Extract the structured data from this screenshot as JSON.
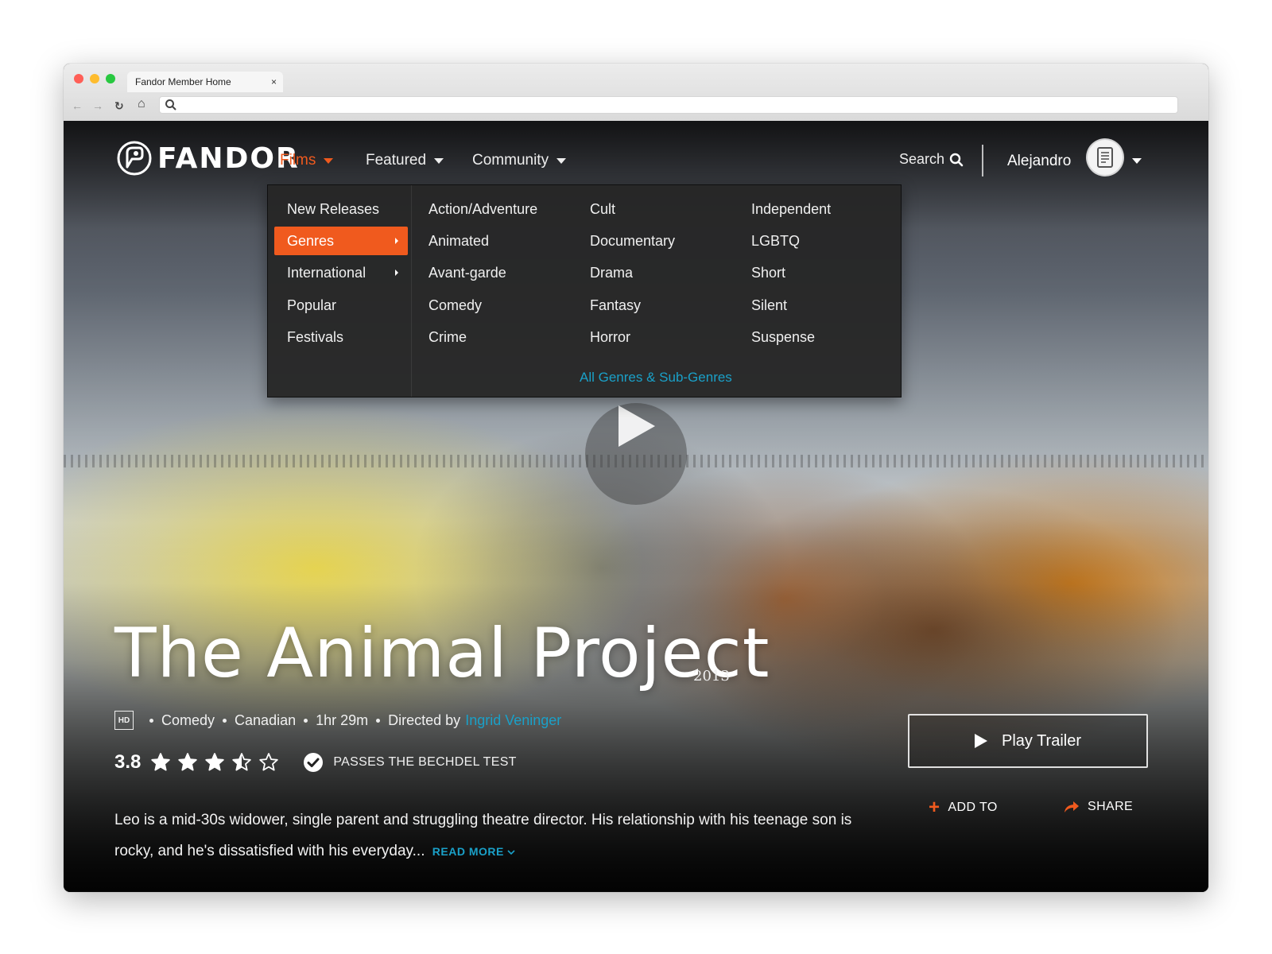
{
  "browser": {
    "tab_title": "Fandor Member Home",
    "tab_close": "×",
    "back": "←",
    "forward": "→",
    "reload": "↻",
    "home": "⌂",
    "url": ""
  },
  "header": {
    "brand": "FANDOR",
    "nav": [
      {
        "label": "Films",
        "active": true
      },
      {
        "label": "Featured",
        "active": false
      },
      {
        "label": "Community",
        "active": false
      }
    ],
    "search_label": "Search",
    "username": "Alejandro",
    "accent_color": "#f05a1e",
    "link_color": "#1aa0c8"
  },
  "dropdown": {
    "left_items": [
      {
        "label": "New Releases",
        "active": false,
        "has_submenu": false
      },
      {
        "label": "Genres",
        "active": true,
        "has_submenu": true
      },
      {
        "label": "International",
        "active": false,
        "has_submenu": true
      },
      {
        "label": "Popular",
        "active": false,
        "has_submenu": false
      },
      {
        "label": "Festivals",
        "active": false,
        "has_submenu": false
      }
    ],
    "genres_col1": [
      "Action/Adventure",
      "Animated",
      "Avant-garde",
      "Comedy",
      "Crime"
    ],
    "genres_col2": [
      "Cult",
      "Documentary",
      "Drama",
      "Fantasy",
      "Horror"
    ],
    "genres_col3": [
      "Independent",
      "LGBTQ",
      "Short",
      "Silent",
      "Suspense"
    ],
    "all_genres": "All Genres & Sub-Genres"
  },
  "film": {
    "title": "The Animal Project",
    "year": "2013",
    "hd_badge": "HD",
    "genre": "Comedy",
    "country": "Canadian",
    "runtime": "1hr 29m",
    "directed_by": "Directed by",
    "director": "Ingrid Veninger",
    "rating": "3.8",
    "rating_value": 3.5,
    "rating_max": 5,
    "bechdel": "PASSES THE BECHDEL TEST",
    "synopsis": "Leo is a mid-30s widower, single parent and struggling theatre director. His relationship with his teenage son is rocky, and he's dissatisfied with his everyday...",
    "read_more": "READ MORE"
  },
  "actions": {
    "play_trailer": "Play Trailer",
    "add_to": "ADD TO",
    "share": "SHARE"
  }
}
